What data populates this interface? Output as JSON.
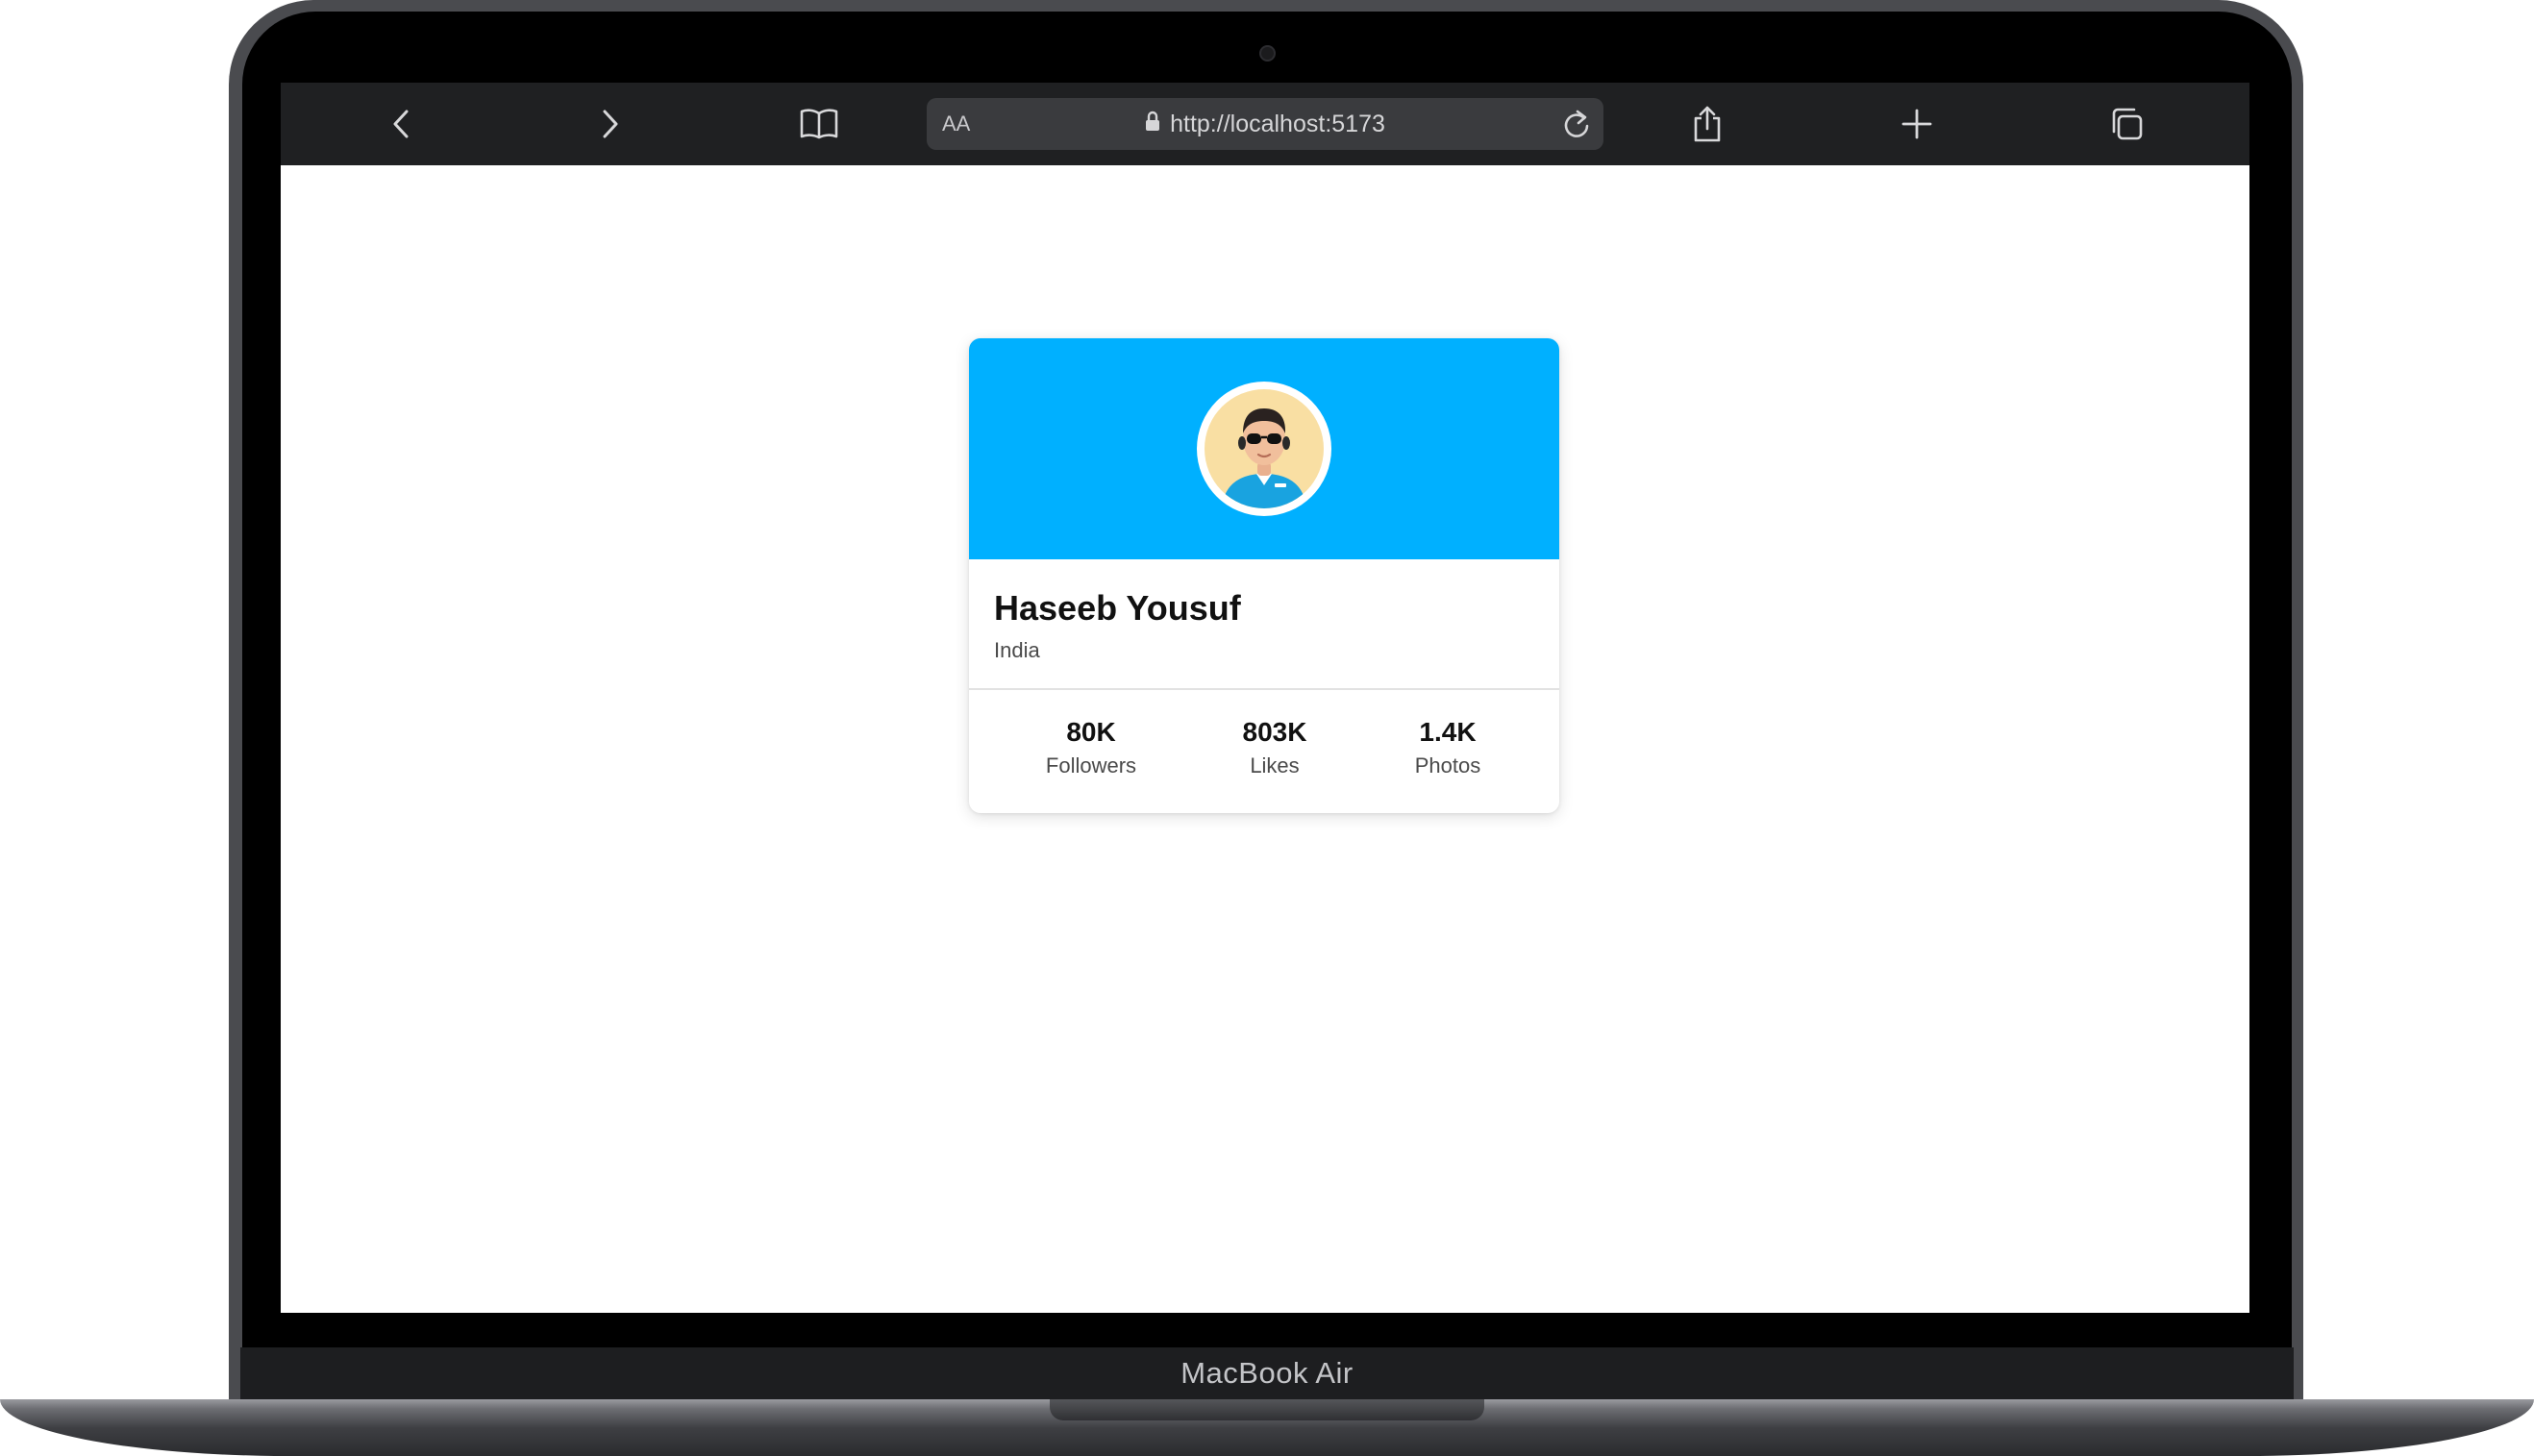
{
  "device": {
    "brand_label": "MacBook Air"
  },
  "browser": {
    "reader_label": "AA",
    "url": "http://localhost:5173",
    "icons": {
      "back": "chevron-left-icon",
      "forward": "chevron-right-icon",
      "bookmarks": "book-icon",
      "lock": "lock-icon",
      "reload": "reload-icon",
      "share": "share-icon",
      "new_tab": "plus-icon",
      "tabs": "tabs-icon"
    }
  },
  "profile": {
    "name": "Haseeb Yousuf",
    "location": "India",
    "header_color": "#00b0ff",
    "stats": [
      {
        "value": "80K",
        "label": "Followers"
      },
      {
        "value": "803K",
        "label": "Likes"
      },
      {
        "value": "1.4K",
        "label": "Photos"
      }
    ]
  }
}
